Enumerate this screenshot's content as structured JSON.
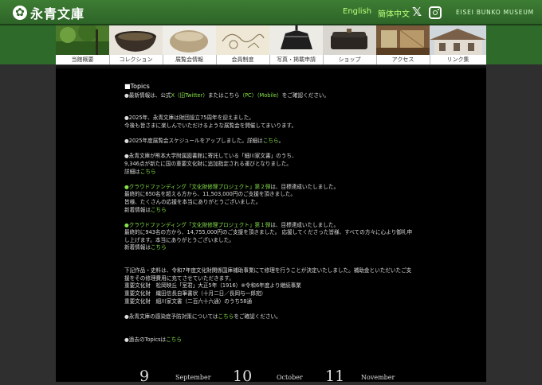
{
  "header": {
    "logo_mark": "✿",
    "logo_text": "永青文庫",
    "lang_english": "English",
    "lang_chinese": "簡体中文",
    "museum_name": "EISEI BUNKO MUSEUM"
  },
  "nav": [
    {
      "label": "当館概要"
    },
    {
      "label": "コレクション"
    },
    {
      "label": "展覧会情報"
    },
    {
      "label": "会員制度"
    },
    {
      "label": "写真・掲載申請"
    },
    {
      "label": "ショップ"
    },
    {
      "label": "アクセス"
    },
    {
      "label": "リンク集"
    }
  ],
  "topics": {
    "heading": "■Topics",
    "sns_a": "●最新情報は、公式",
    "sns_link1": "X（旧Twitter）",
    "sns_b": "またはこちら",
    "sns_link2": "（PC）（Mobile）",
    "sns_c": "をご確認ください。",
    "anniv_1": "●2025年、永青文庫は財団設立75周年を迎えました。",
    "anniv_2": "今後も皆さまに楽しんでいただけるような展覧会を開催してまいります。",
    "sched_a": "●2025年度展覧会スケジュールをアップしました。詳細は",
    "sched_link": "こちら",
    "sched_b": "。",
    "hoso_1": "●永青文庫が熊本大学附属図書館に寄託している「細川家文書」のうち、",
    "hoso_2": "9,346点が新たに国の重要文化財に追加指定される運びとなりました。",
    "hoso_3a": "詳細は",
    "hoso_3link": "こちら",
    "cf2_link": "●クラウドファンディング「文化財修理プロジェクト」第２弾",
    "cf2_a": "は、目標達成いたしました。",
    "cf2_2": "最終的に650名を超える方から、11,503,000円のご支援を頂きました。",
    "cf2_3": "皆様、たくさんの応援を本当にありがとうございました。",
    "cf2_4a": "新着情報は",
    "cf2_4link": "こちら",
    "cf1_link": "●クラウドファンディング「文化財修理プロジェクト」第１弾",
    "cf1_a": "は、目標達成いたしました。",
    "cf1_2": "最終的に943名の方から、14,755,000円のご支援を頂きました。 応援してくださった皆様、すべての方々に心より御礼申",
    "cf1_3": "し上げます。本当にありがとうございました。",
    "cf1_4a": "新着情報は",
    "cf1_4link": "こちら",
    "rep_1": "下記作品・史料は、令和7年度文化財関係国庫補助事業にて修理を行うことが決定いたしました。補助金といただいたご支",
    "rep_2": "援をその修理費用に充てさせていただきます。",
    "rep_3": "重要文化財　松岡映丘「室君」大正5年（1916）※令和6年度より継続事業",
    "rep_4": "重要文化財　織田信長自筆書状（十月二日／長岡与一郎宛）",
    "rep_5": "重要文化財　細川家文書（二百六十六通）のうち58通",
    "inf_a": "●永青文庫の感染症予防対策については",
    "inf_link": "こちら",
    "inf_b": "をご確認ください。",
    "past_a": "●過去のTopicsは",
    "past_link": "こちら"
  },
  "calendar": [
    {
      "num": "9",
      "month": "September"
    },
    {
      "num": "10",
      "month": "October"
    },
    {
      "num": "11",
      "month": "November"
    }
  ],
  "colors": {
    "brand_green": "#2e6428",
    "link_green": "#86e24a",
    "lang_link": "#b9ff7a"
  }
}
